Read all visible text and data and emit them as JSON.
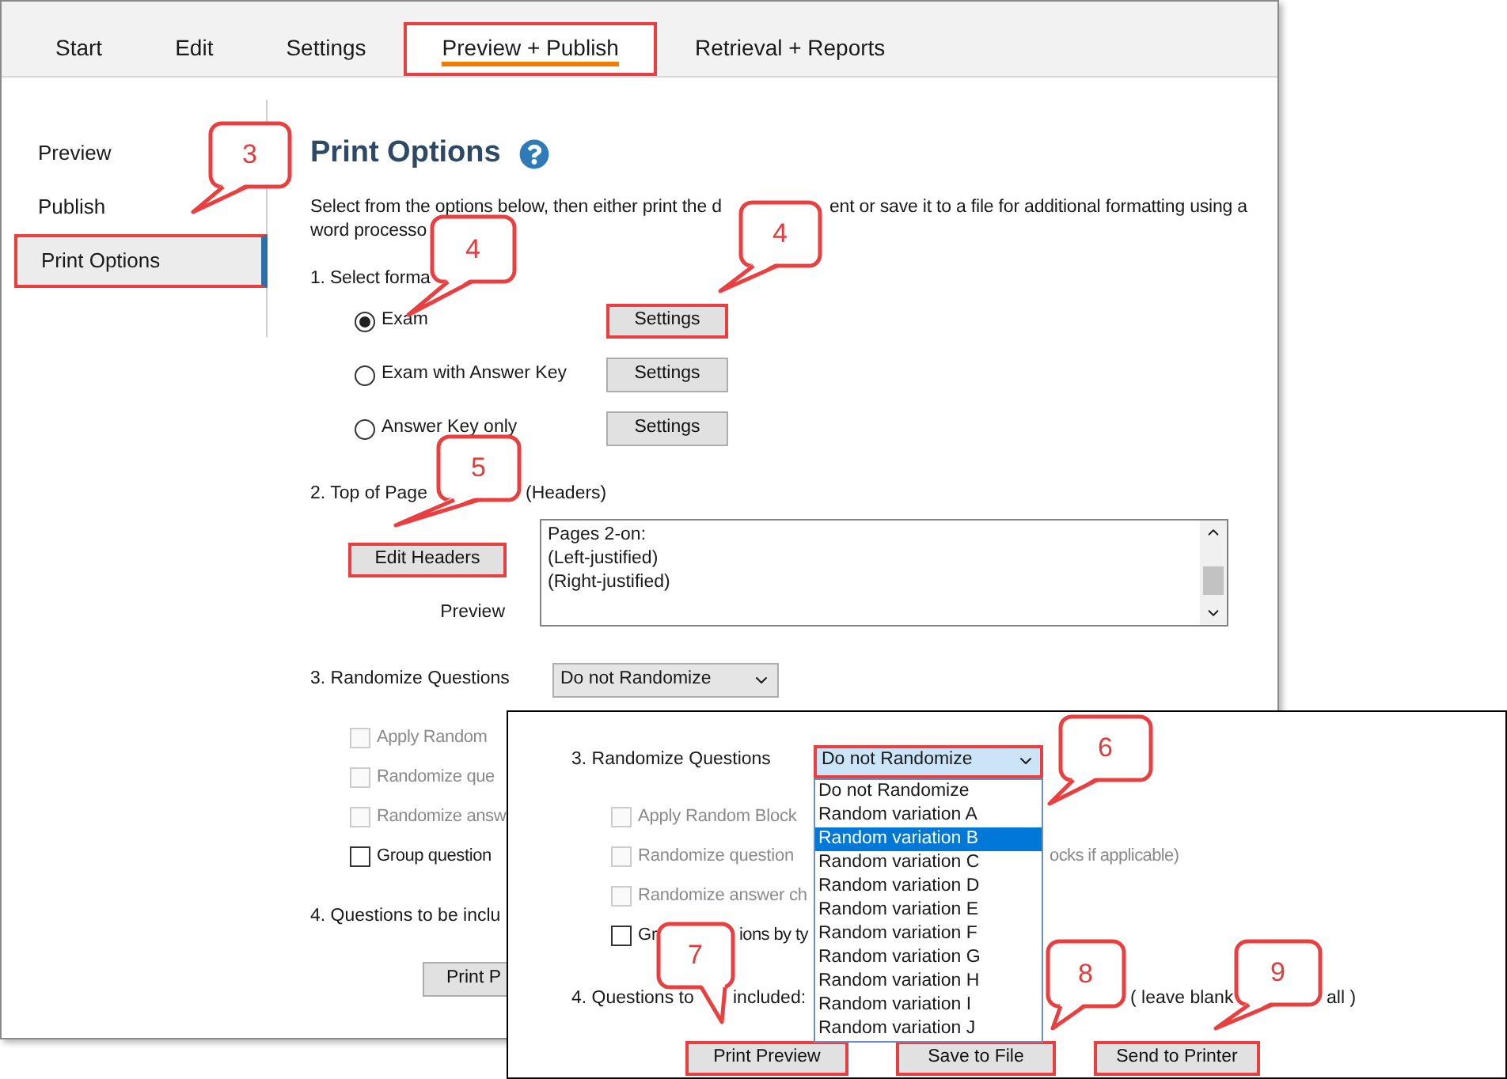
{
  "tabs": [
    {
      "label": "Start",
      "selected": false,
      "highlighted": false
    },
    {
      "label": "Edit",
      "selected": false,
      "highlighted": false
    },
    {
      "label": "Settings",
      "selected": false,
      "highlighted": false
    },
    {
      "label": "Preview + Publish",
      "selected": true,
      "highlighted": true
    },
    {
      "label": "Retrieval + Reports",
      "selected": false,
      "highlighted": false
    }
  ],
  "sidebar": {
    "items": [
      {
        "label": "Preview",
        "selected": false,
        "highlighted": false
      },
      {
        "label": "Publish",
        "selected": false,
        "highlighted": false
      },
      {
        "label": "Print Options",
        "selected": true,
        "highlighted": true
      }
    ]
  },
  "print_options": {
    "title": "Print Options",
    "description": [
      "Select from the options below, then either print the d",
      "ent or save it to a file for additional formatting using a",
      "word processo"
    ],
    "format_heading": "1. Select forma",
    "formats": [
      {
        "label": "Exam",
        "selected": true,
        "button": "Settings",
        "highlighted": true
      },
      {
        "label": "Exam with Answer Key",
        "selected": false,
        "button": "Settings",
        "highlighted": false
      },
      {
        "label": "Answer Key only",
        "selected": false,
        "button": "Settings",
        "highlighted": false
      }
    ],
    "headers_heading": [
      "2. Top of Page",
      "(Headers)"
    ],
    "edit_headers": {
      "label": "Edit Headers",
      "highlighted": true
    },
    "preview_label": "Preview",
    "header_preview": [
      "Pages 2-on:",
      "(Left-justified)",
      "(Right-justified)"
    ],
    "randomize_label": "3. Randomize Questions",
    "randomize_value": "Do not Randomize",
    "options": [
      {
        "label": "Apply Random",
        "checked": false,
        "disabled": true
      },
      {
        "label": "Randomize que",
        "checked": false,
        "disabled": true
      },
      {
        "label": "Randomize answ",
        "checked": false,
        "disabled": true
      },
      {
        "label": "Group question",
        "checked": false,
        "disabled": false
      }
    ],
    "questions_label": "4. Questions to be inclu",
    "print_button": "Print P"
  },
  "zoomed_panel": {
    "randomize_label": "3. Randomize Questions",
    "select": {
      "value": "Do not Randomize",
      "highlighted": true
    },
    "dropdown": [
      {
        "label": "Do not Randomize",
        "selected": false
      },
      {
        "label": "Random variation A",
        "selected": false
      },
      {
        "label": "Random variation B",
        "selected": true
      },
      {
        "label": "Random variation C",
        "selected": false
      },
      {
        "label": "Random variation D",
        "selected": false
      },
      {
        "label": "Random variation E",
        "selected": false
      },
      {
        "label": "Random variation F",
        "selected": false
      },
      {
        "label": "Random variation G",
        "selected": false
      },
      {
        "label": "Random variation H",
        "selected": false
      },
      {
        "label": "Random variation I",
        "selected": false
      },
      {
        "label": "Random variation J",
        "selected": false
      }
    ],
    "options": [
      {
        "parts": [
          "Apply Random Block"
        ],
        "checked": false,
        "disabled": true
      },
      {
        "parts": [
          "Randomize question",
          "ocks if applicable)"
        ],
        "checked": false,
        "disabled": true
      },
      {
        "parts": [
          "Randomize answer ch"
        ],
        "checked": false,
        "disabled": true
      },
      {
        "parts": [
          "Gr",
          "ions by ty"
        ],
        "checked": false,
        "disabled": false
      }
    ],
    "questions_parts": [
      "4. Questions to",
      "included:",
      "( leave blank",
      "all )"
    ],
    "buttons": [
      {
        "label": "Print Preview",
        "highlighted": true
      },
      {
        "label": "Save to File",
        "highlighted": true
      },
      {
        "label": "Send to Printer",
        "highlighted": true
      }
    ]
  },
  "callouts": [
    {
      "number": "3"
    },
    {
      "number": "4"
    },
    {
      "number": "4"
    },
    {
      "number": "5"
    },
    {
      "number": "6"
    },
    {
      "number": "7"
    },
    {
      "number": "8"
    },
    {
      "number": "9"
    }
  ]
}
